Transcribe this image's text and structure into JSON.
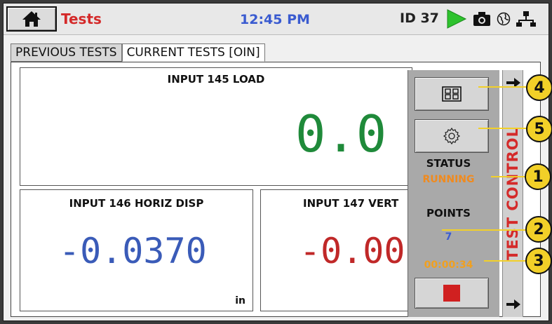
{
  "topbar": {
    "app_title": "Tests",
    "clock": "12:45 PM",
    "device_id": "ID 37",
    "icons": [
      "home-icon",
      "play-icon",
      "camera-icon",
      "globe-icon",
      "network-icon"
    ]
  },
  "tabs": [
    {
      "label": "PREVIOUS TESTS",
      "active": false
    },
    {
      "label": "CURRENT TESTS [OIN]",
      "active": true
    }
  ],
  "panels": {
    "load": {
      "title": "INPUT 145 LOAD",
      "value": "0.0",
      "color": "#1f8a3a"
    },
    "horiz": {
      "title": "INPUT 146 HORIZ DISP",
      "value": "-0.0370",
      "unit": "in",
      "color": "#3a5bb8"
    },
    "vert": {
      "title": "INPUT 147 VERT",
      "value": "-0.00",
      "color": "#c02828"
    }
  },
  "side_panel": {
    "layout_button_icon": "grid-layout-icon",
    "settings_button_icon": "gear-icon",
    "stop_button_icon": "stop-icon",
    "status_label": "STATUS",
    "status_value": "RUNNING",
    "status_color": "#f08a1e",
    "points_label": "POINTS",
    "points_value": "7",
    "points_color": "#3a5bd0",
    "elapsed": "00:00:34",
    "elapsed_color": "#f0a020",
    "stop_color": "#d02020"
  },
  "test_control_tab": {
    "label": "TEST CONTROL",
    "arrow_icons": [
      "arrow-right-icon",
      "arrow-right-icon"
    ]
  },
  "callouts": [
    "1",
    "2",
    "3",
    "4",
    "5"
  ],
  "colors": {
    "accent_red": "#d42a2a",
    "callout_yellow": "#f2d028"
  }
}
